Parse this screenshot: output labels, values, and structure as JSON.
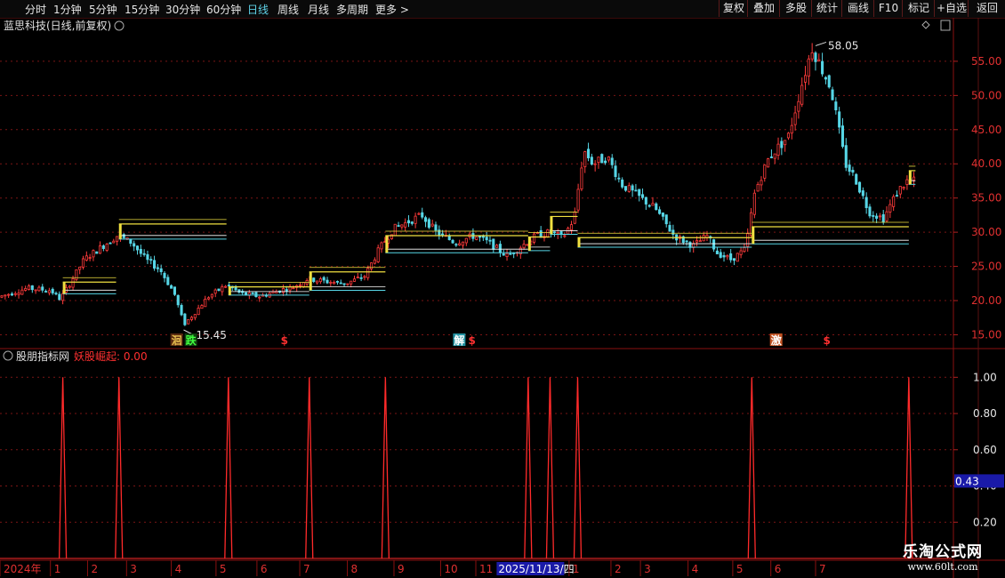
{
  "toolbar": {
    "left": [
      "分时",
      "1分钟",
      "5分钟",
      "15分钟",
      "30分钟",
      "60分钟",
      "日线",
      "周线",
      "月线",
      "多周期",
      "更多"
    ],
    "active": "日线",
    "right": [
      "复权",
      "叠加",
      "多股",
      "统计",
      "画线",
      "F10",
      "标记",
      "+自选",
      "返回"
    ]
  },
  "stock_title": "蓝思科技(日线,前复权)",
  "indicator": {
    "name": "股朋指标网",
    "series_label": "妖股崛起: 0.00",
    "current_value": "0.43"
  },
  "annotations": {
    "high_label": "58.05",
    "low_label": "15.45"
  },
  "signals": [
    {
      "text": "洄",
      "color": "#e8c050",
      "bg": "#5a2a10",
      "x": 0.18
    },
    {
      "text": "跌",
      "color": "#40ff40",
      "bg": "#104010",
      "x": 0.195
    },
    {
      "text": "$",
      "color": "#ff3030",
      "bg": "",
      "x": 0.295
    },
    {
      "text": "解",
      "color": "#ffffff",
      "bg": "#2090a0",
      "x": 0.477
    },
    {
      "text": "$",
      "color": "#ff3030",
      "bg": "",
      "x": 0.492
    },
    {
      "text": "激",
      "color": "#ffffff",
      "bg": "#c05020",
      "x": 0.81
    },
    {
      "text": "$",
      "color": "#ff3030",
      "bg": "",
      "x": 0.865
    }
  ],
  "time_axis": [
    {
      "label": "2024年",
      "x": 0.0
    },
    {
      "label": "1",
      "x": 0.053
    },
    {
      "label": "2",
      "x": 0.092
    },
    {
      "label": "3",
      "x": 0.133
    },
    {
      "label": "4",
      "x": 0.18
    },
    {
      "label": "5",
      "x": 0.227
    },
    {
      "label": "6",
      "x": 0.27
    },
    {
      "label": "7",
      "x": 0.315
    },
    {
      "label": "8",
      "x": 0.365
    },
    {
      "label": "9",
      "x": 0.414
    },
    {
      "label": "10",
      "x": 0.463
    },
    {
      "label": "11",
      "x": 0.5
    },
    {
      "label": "2025/11/13/四",
      "x": 0.52
    },
    {
      "label": "1",
      "x": 0.598
    },
    {
      "label": "2",
      "x": 0.642
    },
    {
      "label": "3",
      "x": 0.673
    },
    {
      "label": "4",
      "x": 0.723
    },
    {
      "label": "5",
      "x": 0.77
    },
    {
      "label": "6",
      "x": 0.81
    },
    {
      "label": "7",
      "x": 0.857
    }
  ],
  "watermark": {
    "line1": "乐淘公式网",
    "line2": "www.60lt.com"
  },
  "chart_data": [
    {
      "type": "candlestick",
      "title": "蓝思科技(日线,前复权)",
      "y_ticks": [
        15,
        20,
        25,
        30,
        35,
        40,
        45,
        50,
        55
      ],
      "ylim": [
        13.5,
        58.5
      ],
      "grid": true,
      "price_path": [
        [
          0,
          20.5
        ],
        [
          0.03,
          21.8
        ],
        [
          0.055,
          21.5
        ],
        [
          0.065,
          20.2
        ],
        [
          0.075,
          22.5
        ],
        [
          0.09,
          26
        ],
        [
          0.11,
          28
        ],
        [
          0.125,
          29.5
        ],
        [
          0.14,
          28.5
        ],
        [
          0.155,
          26
        ],
        [
          0.17,
          24.5
        ],
        [
          0.185,
          21
        ],
        [
          0.195,
          16.5
        ],
        [
          0.205,
          18
        ],
        [
          0.22,
          20.5
        ],
        [
          0.24,
          22.3
        ],
        [
          0.255,
          21
        ],
        [
          0.275,
          20.6
        ],
        [
          0.295,
          21.5
        ],
        [
          0.31,
          22
        ],
        [
          0.325,
          23.2
        ],
        [
          0.345,
          22.8
        ],
        [
          0.365,
          22.5
        ],
        [
          0.385,
          23.6
        ],
        [
          0.4,
          27.5
        ],
        [
          0.415,
          30.5
        ],
        [
          0.43,
          31.5
        ],
        [
          0.445,
          32.5
        ],
        [
          0.46,
          30
        ],
        [
          0.48,
          28.5
        ],
        [
          0.5,
          29.5
        ],
        [
          0.515,
          28.5
        ],
        [
          0.535,
          26.5
        ],
        [
          0.55,
          28
        ],
        [
          0.565,
          29.5
        ],
        [
          0.58,
          30
        ],
        [
          0.593,
          29.2
        ],
        [
          0.605,
          32
        ],
        [
          0.615,
          42
        ],
        [
          0.625,
          40
        ],
        [
          0.64,
          41
        ],
        [
          0.655,
          37
        ],
        [
          0.67,
          35.5
        ],
        [
          0.69,
          33.5
        ],
        [
          0.71,
          29.5
        ],
        [
          0.73,
          28
        ],
        [
          0.745,
          29.5
        ],
        [
          0.755,
          27
        ],
        [
          0.77,
          26
        ],
        [
          0.785,
          27.5
        ],
        [
          0.795,
          36
        ],
        [
          0.81,
          41
        ],
        [
          0.83,
          44
        ],
        [
          0.845,
          52
        ],
        [
          0.855,
          57
        ],
        [
          0.865,
          54
        ],
        [
          0.875,
          51
        ],
        [
          0.89,
          40
        ],
        [
          0.9,
          38
        ],
        [
          0.915,
          33
        ],
        [
          0.93,
          32
        ],
        [
          0.945,
          36
        ],
        [
          0.955,
          37.5
        ],
        [
          0.962,
          37.5
        ]
      ],
      "high": 58.05,
      "low": 15.45,
      "boxes": [
        {
          "x0": 0.066,
          "x1": 0.122,
          "top": 22.7,
          "bottom": 21.0
        },
        {
          "x0": 0.125,
          "x1": 0.238,
          "top": 31.2,
          "bottom": 29.0
        },
        {
          "x0": 0.24,
          "x1": 0.325,
          "top": 22.0,
          "bottom": 20.8
        },
        {
          "x0": 0.325,
          "x1": 0.405,
          "top": 24.2,
          "bottom": 21.5
        },
        {
          "x0": 0.405,
          "x1": 0.555,
          "top": 29.5,
          "bottom": 27.0
        },
        {
          "x0": 0.555,
          "x1": 0.578,
          "top": 29.3,
          "bottom": 27.3
        },
        {
          "x0": 0.578,
          "x1": 0.607,
          "top": 32.3,
          "bottom": 29.7
        },
        {
          "x0": 0.607,
          "x1": 0.79,
          "top": 29.2,
          "bottom": 27.8
        },
        {
          "x0": 0.79,
          "x1": 0.955,
          "top": 30.8,
          "bottom": 28.3
        },
        {
          "x0": 0.955,
          "x1": 0.962,
          "top": 39.0,
          "bottom": 37.0
        }
      ]
    },
    {
      "type": "line",
      "series": [
        {
          "name": "妖股崛起",
          "values": [
            0,
            1,
            0,
            1,
            0,
            1,
            0,
            1,
            0,
            1,
            0,
            1,
            0,
            1,
            0,
            1,
            0,
            1,
            0,
            1,
            0
          ]
        }
      ],
      "spike_x": [
        0.066,
        0.125,
        0.24,
        0.325,
        0.405,
        0.555,
        0.578,
        0.607,
        0.79,
        0.955
      ],
      "y_ticks": [
        0.2,
        0.4,
        0.6,
        0.8,
        1.0
      ],
      "ylim": [
        0,
        1.08
      ],
      "current": 0.43
    }
  ]
}
